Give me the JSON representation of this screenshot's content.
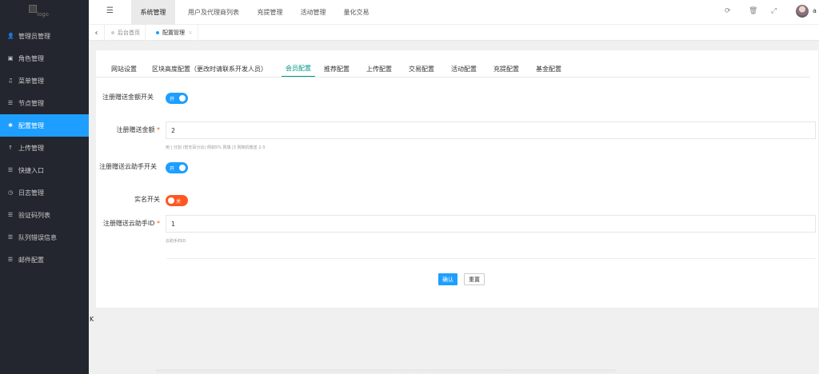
{
  "logo": {
    "alt": "logo"
  },
  "sidebar": {
    "items": [
      {
        "label": "管理员管理",
        "icon": "user-icon"
      },
      {
        "label": "角色管理",
        "icon": "id-card-icon"
      },
      {
        "label": "菜单管理",
        "icon": "bell-icon"
      },
      {
        "label": "节点管理",
        "icon": "list-icon"
      },
      {
        "label": "配置管理",
        "icon": "gear-icon",
        "active": true
      },
      {
        "label": "上传管理",
        "icon": "upload-arrow-icon"
      },
      {
        "label": "快捷入口",
        "icon": "list-icon"
      },
      {
        "label": "日志管理",
        "icon": "clock-icon"
      },
      {
        "label": "验证码列表",
        "icon": "list-icon"
      },
      {
        "label": "队列错误信息",
        "icon": "list-icon"
      },
      {
        "label": "邮件配置",
        "icon": "list-icon"
      }
    ]
  },
  "topnav": {
    "items": [
      "系统管理",
      "用户及代理商列表",
      "充提管理",
      "活动管理",
      "量化交易"
    ],
    "username": "a"
  },
  "tabs": {
    "home": "后台首页",
    "current": "配置管理",
    "close": "×"
  },
  "form_tabs": [
    "网站设置",
    "区块高度配置（更改时请联系开发人员）",
    "会员配置",
    "推荐配置",
    "上传配置",
    "交易配置",
    "活动配置",
    "充提配置",
    "基金配置"
  ],
  "form": {
    "reg_bonus_switch": {
      "label": "注册赠送金额开关",
      "state": "开"
    },
    "reg_bonus_amount": {
      "label": "注册赠送金额",
      "value": "2",
      "hint": "用 | 分割 (暂无百分比) 例如5% 则填 |3 则随机赠送 2-3"
    },
    "reg_assistant_switch": {
      "label": "注册赠送云助手开关",
      "state": "开"
    },
    "realname_switch": {
      "label": "实名开关",
      "state": "关"
    },
    "reg_assistant_id": {
      "label": "注册赠送云助手ID",
      "value": "1",
      "hint": "云助手的ID"
    }
  },
  "buttons": {
    "confirm": "确认",
    "reset": "重置"
  },
  "stray_text": "K",
  "colors": {
    "sidebar_bg": "#23262e",
    "active_blue": "#1e9fff",
    "tab_green": "#009688",
    "switch_off": "#ff5722"
  }
}
